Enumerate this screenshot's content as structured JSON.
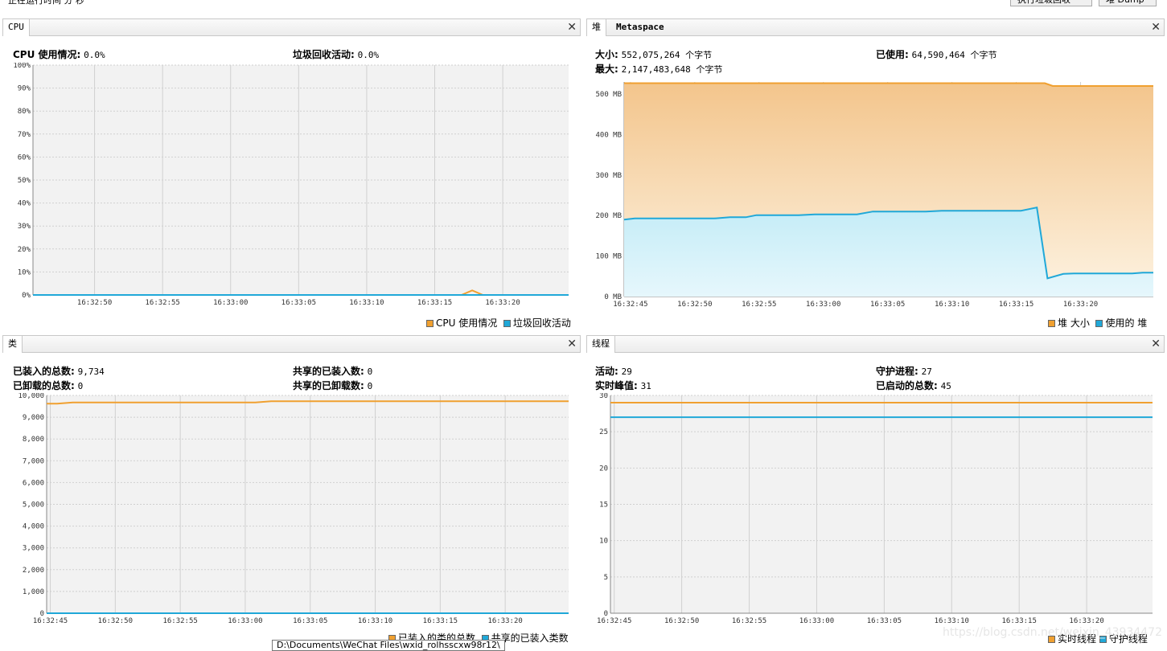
{
  "top": {
    "left_text": "正在运行时间  分 秒",
    "gc_button": "执行垃圾回收",
    "dump_button": "堆 Dump"
  },
  "cpu": {
    "tab": "CPU",
    "stat1_label": "CPU 使用情况:",
    "stat1_value": "0.0%",
    "stat2_label": "垃圾回收活动:",
    "stat2_value": "0.0%",
    "legend": [
      "CPU 使用情况",
      "垃圾回收活动"
    ]
  },
  "heap": {
    "tabs": [
      "堆",
      "Metaspace"
    ],
    "size_label": "大小:",
    "size_value": "552,075,264 个字节",
    "max_label": "最大:",
    "max_value": "2,147,483,648 个字节",
    "used_label": "已使用:",
    "used_value": "64,590,464 个字节",
    "legend": [
      "堆 大小",
      "使用的 堆"
    ]
  },
  "classes": {
    "tab": "类",
    "loaded_label": "已装入的总数:",
    "loaded_value": "9,734",
    "unloaded_label": "已卸载的总数:",
    "unloaded_value": "0",
    "shared_loaded_label": "共享的已装入数:",
    "shared_loaded_value": "0",
    "shared_unloaded_label": "共享的已卸载数:",
    "shared_unloaded_value": "0",
    "legend": [
      "已装入的类的总数",
      "共享的已装入类数"
    ]
  },
  "threads": {
    "tab": "线程",
    "live_label": "活动:",
    "live_value": "29",
    "peak_label": "实时峰值:",
    "peak_value": "31",
    "daemon_label": "守护进程:",
    "daemon_value": "27",
    "started_label": "已启动的总数:",
    "started_value": "45",
    "legend": [
      "实时线程",
      "守护线程"
    ]
  },
  "tooltip": "D:\\Documents\\WeChat Files\\wxid_rolhsscxw98r12\\",
  "watermark": "https://blog.csdn.net/weixin_43934472",
  "colors": {
    "orange": "#f0a030",
    "blue": "#20a8d8",
    "grid": "#d0d0d0",
    "plot_bg": "#f2f2f2"
  },
  "chart_data": [
    {
      "id": "cpu",
      "type": "line",
      "x": [
        "16:32:50",
        "16:32:55",
        "16:33:00",
        "16:33:05",
        "16:33:10",
        "16:33:15",
        "16:33:20"
      ],
      "ylim": [
        0,
        100
      ],
      "yticks": [
        "0%",
        "10%",
        "20%",
        "30%",
        "40%",
        "50%",
        "60%",
        "70%",
        "80%",
        "90%",
        "100%"
      ],
      "series": [
        {
          "name": "CPU 使用情况",
          "color": "#f0a030",
          "points": [
            [
              0,
              0
            ],
            [
              0.8,
              0
            ],
            [
              0.82,
              2
            ],
            [
              0.84,
              0
            ],
            [
              1,
              0
            ]
          ]
        },
        {
          "name": "垃圾回收活动",
          "color": "#20a8d8",
          "points": [
            [
              0,
              0
            ],
            [
              1,
              0
            ]
          ]
        }
      ]
    },
    {
      "id": "heap",
      "type": "area",
      "x": [
        "16:32:45",
        "16:32:50",
        "16:32:55",
        "16:33:00",
        "16:33:05",
        "16:33:10",
        "16:33:15",
        "16:33:20"
      ],
      "ylim": [
        0,
        530
      ],
      "yticks": [
        "0 MB",
        "100 MB",
        "200 MB",
        "300 MB",
        "400 MB",
        "500 MB"
      ],
      "series": [
        {
          "name": "堆 大小",
          "color": "#f0a030",
          "points": [
            [
              0,
              527
            ],
            [
              0.795,
              527
            ],
            [
              0.81,
              520
            ],
            [
              1,
              520
            ]
          ]
        },
        {
          "name": "使用的 堆",
          "color": "#20a8d8",
          "points": [
            [
              0,
              190
            ],
            [
              0.02,
              193
            ],
            [
              0.17,
              193
            ],
            [
              0.2,
              196
            ],
            [
              0.23,
              196
            ],
            [
              0.25,
              201
            ],
            [
              0.33,
              201
            ],
            [
              0.36,
              203
            ],
            [
              0.44,
              203
            ],
            [
              0.47,
              210
            ],
            [
              0.57,
              210
            ],
            [
              0.6,
              212
            ],
            [
              0.75,
              212
            ],
            [
              0.78,
              220
            ],
            [
              0.8,
              45
            ],
            [
              0.83,
              56
            ],
            [
              0.85,
              57
            ],
            [
              0.96,
              57
            ],
            [
              0.98,
              59
            ],
            [
              1,
              59
            ]
          ]
        }
      ]
    },
    {
      "id": "classes",
      "type": "line",
      "x": [
        "16:32:45",
        "16:32:50",
        "16:32:55",
        "16:33:00",
        "16:33:05",
        "16:33:10",
        "16:33:15",
        "16:33:20"
      ],
      "ylim": [
        0,
        10000
      ],
      "yticks": [
        "0",
        "1,000",
        "2,000",
        "3,000",
        "4,000",
        "5,000",
        "6,000",
        "7,000",
        "8,000",
        "9,000",
        "10,000"
      ],
      "series": [
        {
          "name": "已装入的类的总数",
          "color": "#f0a030",
          "points": [
            [
              0,
              9620
            ],
            [
              0.02,
              9620
            ],
            [
              0.05,
              9680
            ],
            [
              0.4,
              9680
            ],
            [
              0.43,
              9734
            ],
            [
              1,
              9734
            ]
          ]
        },
        {
          "name": "共享的已装入类数",
          "color": "#20a8d8",
          "points": [
            [
              0,
              0
            ],
            [
              1,
              0
            ]
          ]
        }
      ]
    },
    {
      "id": "threads",
      "type": "line",
      "x": [
        "16:32:45",
        "16:32:50",
        "16:32:55",
        "16:33:00",
        "16:33:05",
        "16:33:10",
        "16:33:15",
        "16:33:20"
      ],
      "ylim": [
        0,
        30
      ],
      "yticks": [
        "0",
        "5",
        "10",
        "15",
        "20",
        "25",
        "30"
      ],
      "series": [
        {
          "name": "实时线程",
          "color": "#f0a030",
          "points": [
            [
              0,
              29
            ],
            [
              1,
              29
            ]
          ]
        },
        {
          "name": "守护线程",
          "color": "#20a8d8",
          "points": [
            [
              0,
              27
            ],
            [
              1,
              27
            ]
          ]
        }
      ]
    }
  ]
}
